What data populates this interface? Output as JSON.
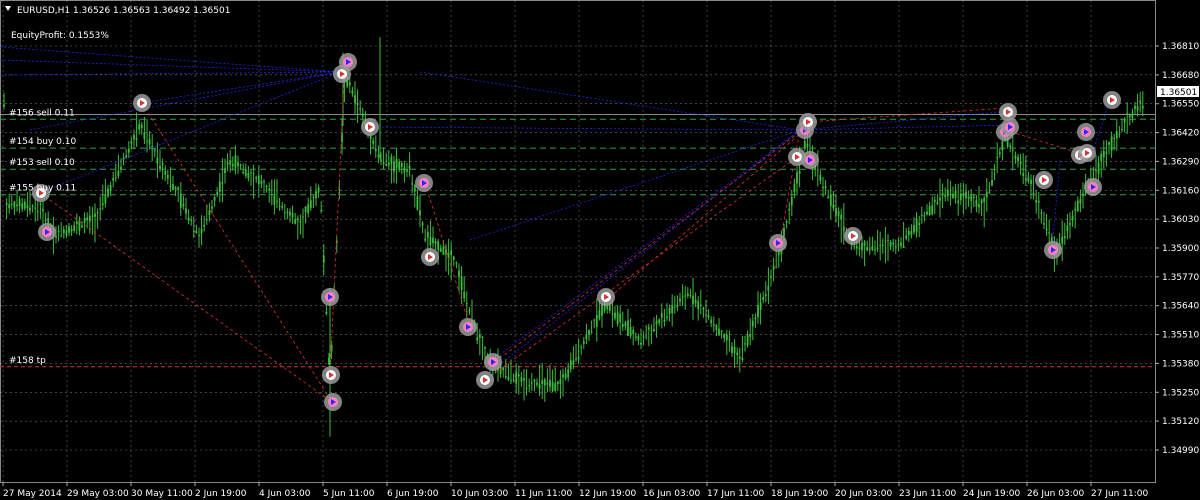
{
  "header": {
    "symbol_line": "EURUSD,H1  1.36526 1.36563 1.36492 1.36501",
    "equity_label": "EquityProfit: 0.1553%"
  },
  "colors": {
    "background": "#000000",
    "grid": "#c8c8c8",
    "candle": "#3cbe3c",
    "order_line": "#2ea043",
    "tp_line": "#d23232",
    "buy_link": "#2828ff",
    "sell_link": "#e03030",
    "price_box": "#ffffff"
  },
  "current_price": "1.36501",
  "price_axis": [
    "1.36810",
    "1.36680",
    "1.36550",
    "1.36420",
    "1.36290",
    "1.36160",
    "1.36030",
    "1.35900",
    "1.35770",
    "1.35640",
    "1.35510",
    "1.35380",
    "1.35250",
    "1.35120",
    "1.34990"
  ],
  "time_axis": [
    "27 May 2014",
    "29 May 03:00",
    "30 May 11:00",
    "2 Jun 19:00",
    "4 Jun 03:00",
    "5 Jun 11:00",
    "6 Jun 19:00",
    "10 Jun 03:00",
    "11 Jun 11:00",
    "12 Jun 19:00",
    "16 Jun 03:00",
    "17 Jun 11:00",
    "18 Jun 19:00",
    "20 Jun 03:00",
    "23 Jun 11:00",
    "24 Jun 19:00",
    "26 Jun 03:00",
    "27 Jun 11:00"
  ],
  "order_labels": [
    {
      "text": "#156 sell 0.11",
      "price": 1.3648
    },
    {
      "text": "#154 buy 0.10",
      "price": 1.3635
    },
    {
      "text": "#153 sell 0.10",
      "price": 1.36255
    },
    {
      "text": "#155 buy 0.11",
      "price": 1.3614
    },
    {
      "text": "#158 tp",
      "price": 1.35365
    }
  ],
  "chart_data": {
    "type": "candlestick",
    "symbol": "EURUSD",
    "timeframe": "H1",
    "ohlc_last": {
      "open": 1.36526,
      "high": 1.36563,
      "low": 1.36492,
      "close": 1.36501
    },
    "ylim": [
      1.34965,
      1.3688
    ],
    "grid": true
  }
}
